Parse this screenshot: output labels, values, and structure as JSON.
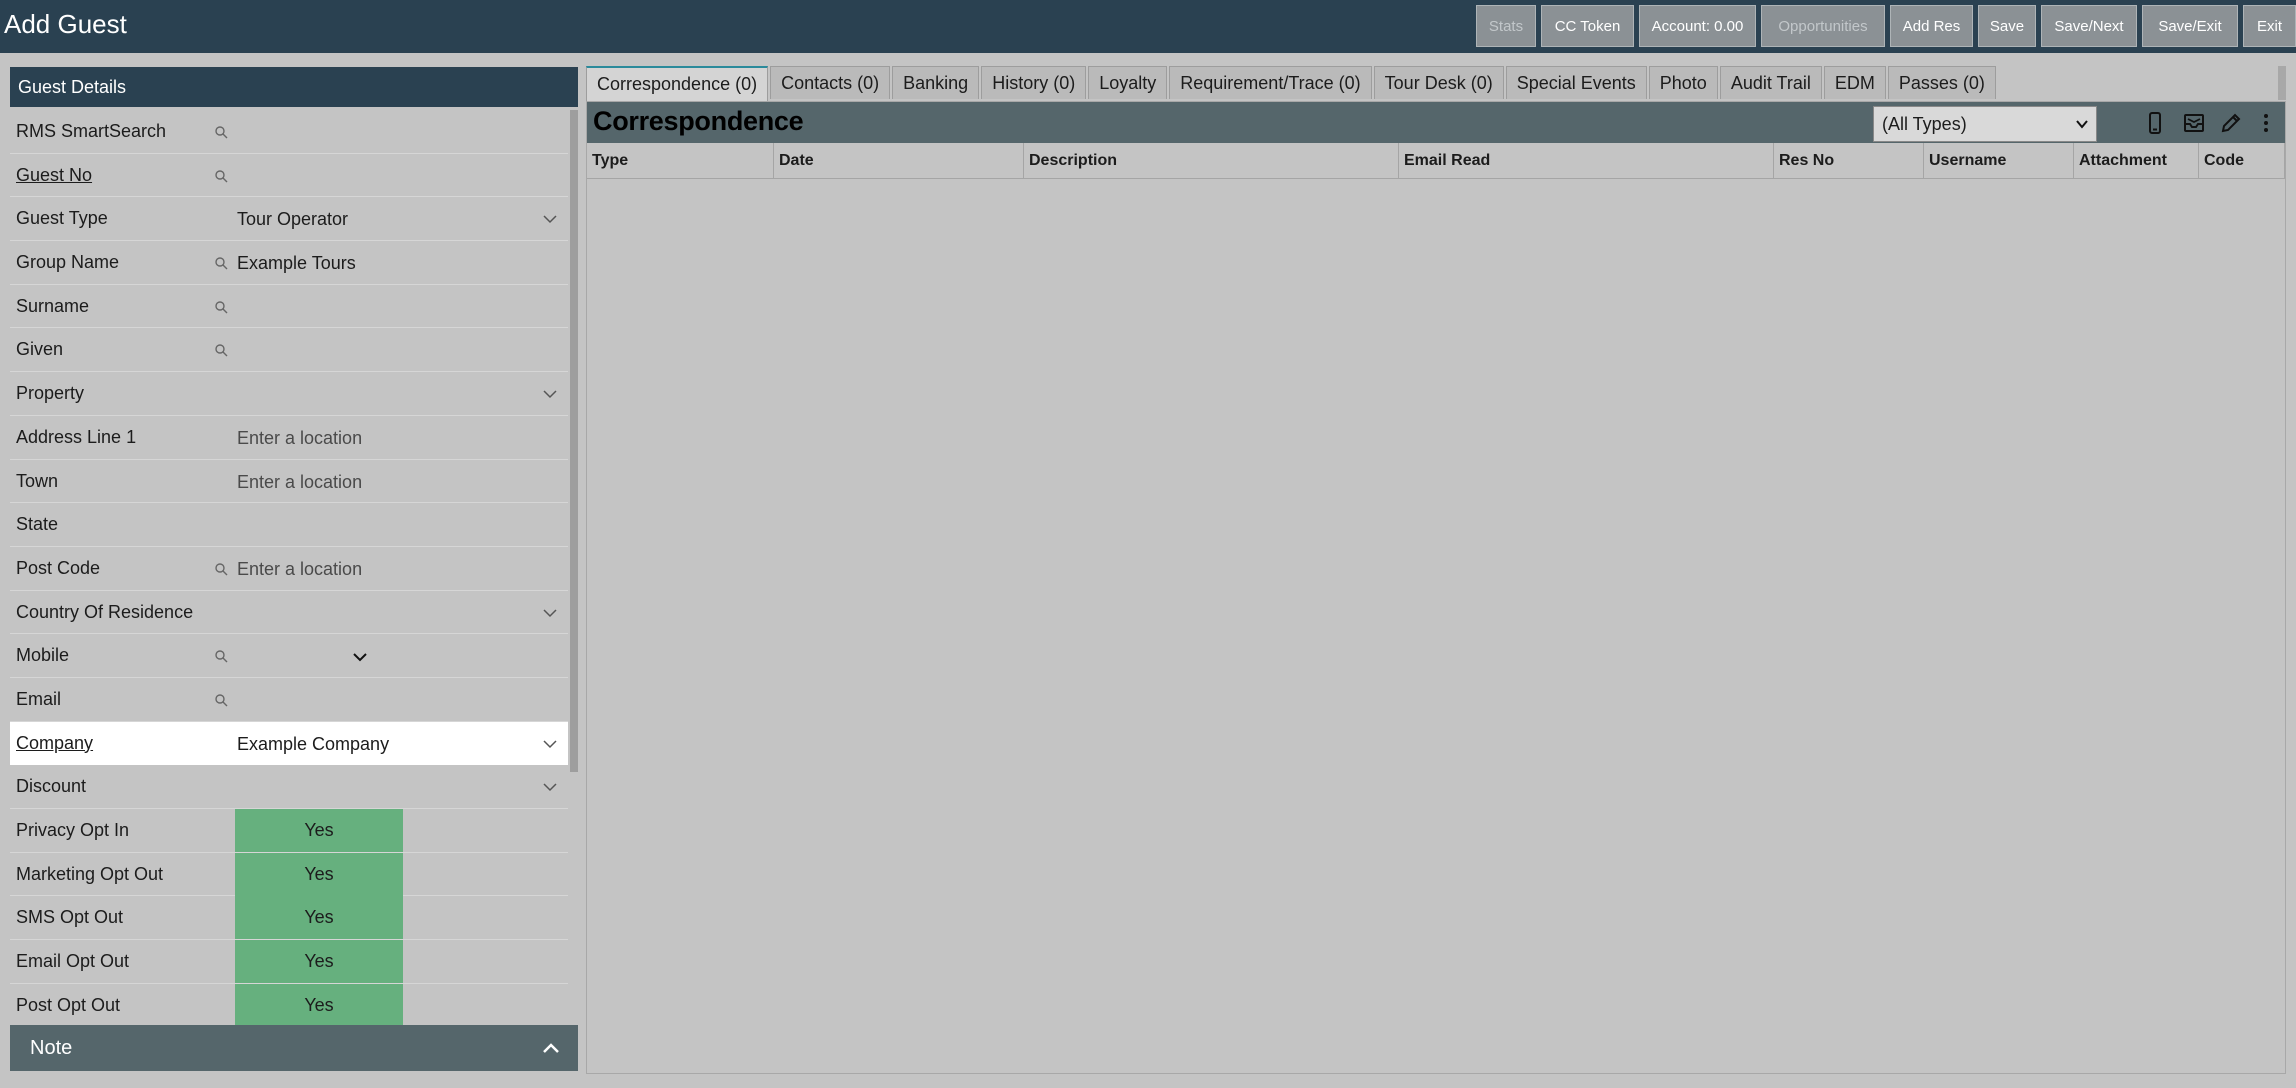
{
  "app": {
    "title": "Add Guest"
  },
  "toolbar": {
    "stats": "Stats",
    "cc_token": "CC Token",
    "account": "Account: 0.00",
    "opportunities": "Opportunities",
    "add_res": "Add Res",
    "save": "Save",
    "save_next": "Save/Next",
    "save_exit": "Save/Exit",
    "exit": "Exit"
  },
  "guest_details": {
    "title": "Guest Details",
    "fields": {
      "smartsearch": {
        "label": "RMS SmartSearch",
        "value": ""
      },
      "guest_no": {
        "label": "Guest No",
        "value": ""
      },
      "guest_type": {
        "label": "Guest Type",
        "value": "Tour Operator"
      },
      "group_name": {
        "label": "Group Name",
        "value": "Example Tours"
      },
      "surname": {
        "label": "Surname",
        "value": ""
      },
      "given": {
        "label": "Given",
        "value": ""
      },
      "property": {
        "label": "Property",
        "value": ""
      },
      "address_line_1": {
        "label": "Address Line 1",
        "placeholder": "Enter a location"
      },
      "town": {
        "label": "Town",
        "placeholder": "Enter a location"
      },
      "state": {
        "label": "State",
        "value": ""
      },
      "post_code": {
        "label": "Post Code",
        "placeholder": "Enter a location"
      },
      "country": {
        "label": "Country Of Residence",
        "value": ""
      },
      "mobile": {
        "label": "Mobile",
        "value": ""
      },
      "email": {
        "label": "Email",
        "value": ""
      },
      "company": {
        "label": "Company",
        "value": "Example Company"
      },
      "discount": {
        "label": "Discount",
        "value": ""
      },
      "privacy_opt_in": {
        "label": "Privacy Opt In",
        "value": "Yes"
      },
      "marketing_opt_out": {
        "label": "Marketing Opt Out",
        "value": "Yes"
      },
      "sms_opt_out": {
        "label": "SMS Opt Out",
        "value": "Yes"
      },
      "email_opt_out": {
        "label": "Email Opt Out",
        "value": "Yes"
      },
      "post_opt_out": {
        "label": "Post Opt Out",
        "value": "Yes"
      }
    },
    "note": "Note"
  },
  "tabs": [
    "Correspondence (0)",
    "Contacts (0)",
    "Banking",
    "History (0)",
    "Loyalty",
    "Requirement/Trace (0)",
    "Tour Desk (0)",
    "Special Events",
    "Photo",
    "Audit Trail",
    "EDM",
    "Passes (0)"
  ],
  "correspondence": {
    "title": "Correspondence",
    "type_filter": "(All Types)",
    "columns": [
      "Type",
      "Date",
      "Description",
      "Email Read",
      "Res No",
      "Username",
      "Attachment",
      "Code"
    ]
  },
  "colors": {
    "header_bg": "#2a4151",
    "panel_bar": "#55666b",
    "yes_green": "#66b07e",
    "page_bg": "#c4c4c4",
    "active_tab_accent": "#2a8a9b"
  },
  "icons": {
    "search": "search-icon",
    "chevron": "chevron-down-icon",
    "mobile": "mobile-phone-icon",
    "mail": "mail-tray-icon",
    "edit": "pencil-icon",
    "more": "more-vertical-icon"
  }
}
